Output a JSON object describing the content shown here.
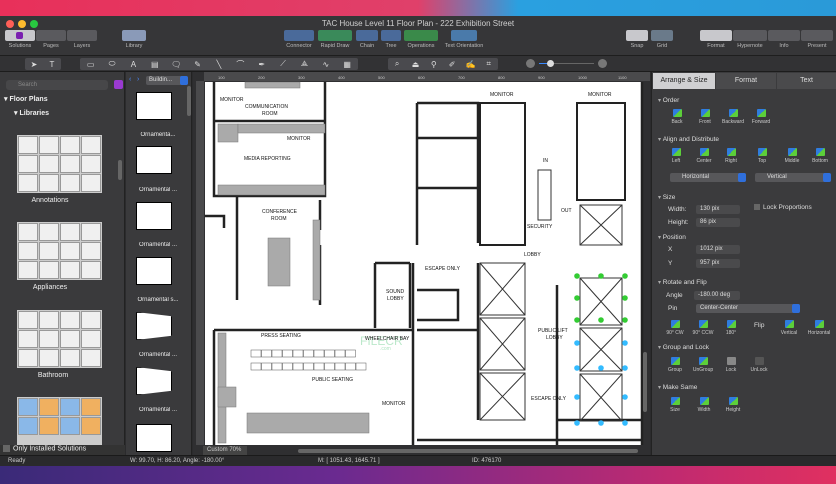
{
  "window": {
    "title": "TAC House Level 11 Floor Plan - 222 Exhibition Street"
  },
  "toolbar": {
    "solutions": "Solutions",
    "pages": "Pages",
    "layers": "Layers",
    "library": "Library",
    "connector": "Connector",
    "rapid_draw": "Rapid Draw",
    "chain": "Chain",
    "tree": "Tree",
    "operations": "Operations",
    "text_orientation": "Text Orientation",
    "snap": "Snap",
    "grid": "Grid",
    "format": "Format",
    "hypernote": "Hypernote",
    "info": "Info",
    "present": "Present"
  },
  "tools": {
    "text_tool": "T",
    "text_a": "A"
  },
  "library": {
    "search_placeholder": "Search",
    "floor_plans": "Floor Plans",
    "libraries": "Libraries",
    "items": [
      "Annotations",
      "Appliances",
      "Bathroom"
    ],
    "only_installed": "Only Installed Solutions"
  },
  "shapes": {
    "dropdown": "Buildin...",
    "items": [
      "Ornamenta...",
      "Ornamental ...",
      "Ornamental ...",
      "Ornamental s...",
      "Ornamental ...",
      "Ornamental ..."
    ]
  },
  "canvas": {
    "ruler": [
      "100",
      "200",
      "300",
      "400",
      "500",
      "600",
      "700",
      "800",
      "900",
      "1000",
      "1100"
    ],
    "zoom": "Custom 70%",
    "watermark": "FILECR",
    "watermark_sub": ".com",
    "labels": {
      "monitor1": "MONITOR",
      "comm1": "COMMUNICATION",
      "comm2": "ROOM",
      "monitor2": "MONITOR",
      "media": "MEDIA REPORTING",
      "conf1": "CONFERENCE",
      "conf2": "ROOM",
      "monitor3": "MONITOR",
      "monitor4": "MONITOR",
      "in": "IN",
      "out": "OUT",
      "security": "SECURITY",
      "lobby": "LOBBY",
      "escape1": "ESCAPE ONLY",
      "sound1": "SOUND",
      "sound2": "LOBBY",
      "press": "PRESS SEATING",
      "wheel": "WHEELCHAIR BAY",
      "public_seating": "PUBLIC SEATING",
      "monitor5": "MONITOR",
      "lift1": "PUBLIC LIFT",
      "lift2": "LOBBY",
      "escape2": "ESCAPE ONLY"
    }
  },
  "panel": {
    "tabs": [
      "Arrange & Size",
      "Format",
      "Text"
    ],
    "order": {
      "title": "Order",
      "buttons": [
        "Back",
        "Front",
        "Backward",
        "Forward"
      ]
    },
    "align": {
      "title": "Align and Distribute",
      "buttons": [
        "Left",
        "Center",
        "Right",
        "Top",
        "Middle",
        "Bottom"
      ],
      "horizontal": "Horizontal",
      "vertical": "Vertical"
    },
    "size": {
      "title": "Size",
      "width_label": "Width:",
      "width": "130 pix",
      "height_label": "Height:",
      "height": "86 pix",
      "lock": "Lock Proportions"
    },
    "position": {
      "title": "Position",
      "x_label": "X",
      "x": "1012 pix",
      "y_label": "Y",
      "y": "957 pix"
    },
    "rotate": {
      "title": "Rotate and Flip",
      "angle_label": "Angle",
      "angle": "-180.00 deg",
      "pin_label": "Pin",
      "pin": "Center-Center",
      "buttons": [
        "90° CW",
        "90° CCW",
        "180°"
      ],
      "flip": "Flip",
      "flip_buttons": [
        "Vertical",
        "Horizontal"
      ]
    },
    "group": {
      "title": "Group and Lock",
      "buttons": [
        "Group",
        "UnGroup",
        "Lock",
        "UnLock"
      ]
    },
    "same": {
      "title": "Make Same",
      "buttons": [
        "Size",
        "Width",
        "Height"
      ]
    }
  },
  "status": {
    "ready": "Ready",
    "dims": "W: 99.70,  H: 86.20,  Angle: -180.00°",
    "mouse": "M: [ 1051.43, 1645.71 ]",
    "id": "ID: 476170"
  }
}
